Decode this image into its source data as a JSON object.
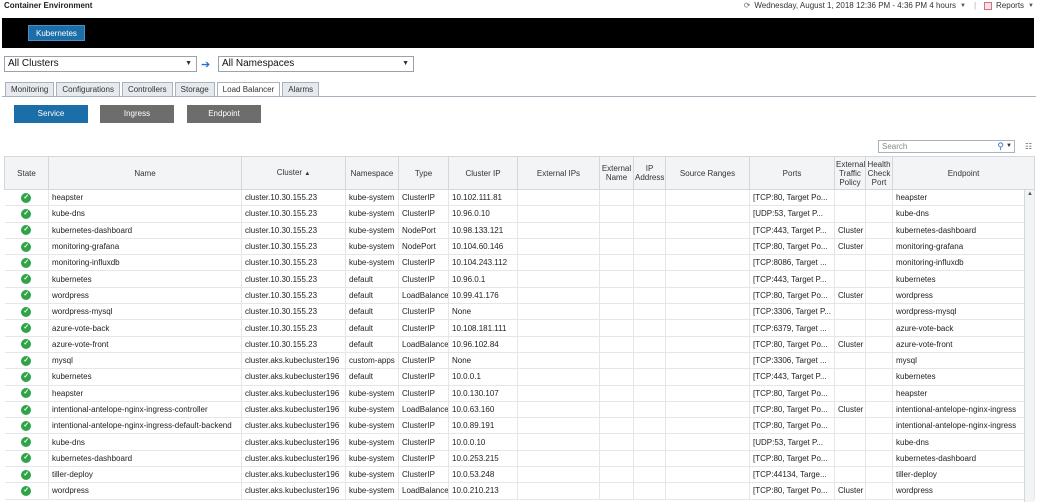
{
  "app": {
    "title": "Container Environment",
    "time_range": "Wednesday, August 1, 2018 12:36 PM - 4:36 PM 4 hours",
    "reports_label": "Reports"
  },
  "header": {
    "kubernetes_button": "Kubernetes"
  },
  "filters": {
    "cluster_value": "All Clusters",
    "namespace_value": "All Namespaces"
  },
  "tabs": [
    {
      "label": "Monitoring"
    },
    {
      "label": "Configurations"
    },
    {
      "label": "Controllers"
    },
    {
      "label": "Storage"
    },
    {
      "label": "Load Balancer",
      "active": true
    },
    {
      "label": "Alarms"
    }
  ],
  "subtabs": {
    "service": "Service",
    "ingress": "Ingress",
    "endpoint": "Endpoint"
  },
  "search": {
    "placeholder": "Search"
  },
  "colors": {
    "accent": "#1b6ea8",
    "ok": "#2fa34a",
    "secondary": "#6d6d6d"
  },
  "table": {
    "columns": [
      "State",
      "Name",
      "Cluster",
      "Namespace",
      "Type",
      "Cluster IP",
      "External IPs",
      "External Name",
      "IP Address",
      "Source Ranges",
      "Ports",
      "External Traffic Policy",
      "Health Check Port",
      "Endpoint"
    ],
    "sorted_column": "Cluster",
    "rows": [
      {
        "state": "ok",
        "name": "heapster",
        "cluster": "cluster.10.30.155.23",
        "namespace": "kube-system",
        "type": "ClusterIP",
        "cluster_ip": "10.102.111.81",
        "external_ips": "",
        "external_name": "",
        "ip_address": "",
        "source_ranges": "",
        "ports": "[TCP:80, Target Po...",
        "traffic_policy": "",
        "health_port": "",
        "endpoint": "heapster"
      },
      {
        "state": "ok",
        "name": "kube-dns",
        "cluster": "cluster.10.30.155.23",
        "namespace": "kube-system",
        "type": "ClusterIP",
        "cluster_ip": "10.96.0.10",
        "external_ips": "",
        "external_name": "",
        "ip_address": "",
        "source_ranges": "",
        "ports": "[UDP:53, Target P...",
        "traffic_policy": "",
        "health_port": "",
        "endpoint": "kube-dns"
      },
      {
        "state": "ok",
        "name": "kubernetes-dashboard",
        "cluster": "cluster.10.30.155.23",
        "namespace": "kube-system",
        "type": "NodePort",
        "cluster_ip": "10.98.133.121",
        "external_ips": "",
        "external_name": "",
        "ip_address": "",
        "source_ranges": "",
        "ports": "[TCP:443, Target P...",
        "traffic_policy": "Cluster",
        "health_port": "",
        "endpoint": "kubernetes-dashboard"
      },
      {
        "state": "ok",
        "name": "monitoring-grafana",
        "cluster": "cluster.10.30.155.23",
        "namespace": "kube-system",
        "type": "NodePort",
        "cluster_ip": "10.104.60.146",
        "external_ips": "",
        "external_name": "",
        "ip_address": "",
        "source_ranges": "",
        "ports": "[TCP:80, Target Po...",
        "traffic_policy": "Cluster",
        "health_port": "",
        "endpoint": "monitoring-grafana"
      },
      {
        "state": "ok",
        "name": "monitoring-influxdb",
        "cluster": "cluster.10.30.155.23",
        "namespace": "kube-system",
        "type": "ClusterIP",
        "cluster_ip": "10.104.243.112",
        "external_ips": "",
        "external_name": "",
        "ip_address": "",
        "source_ranges": "",
        "ports": "[TCP:8086, Target ...",
        "traffic_policy": "",
        "health_port": "",
        "endpoint": "monitoring-influxdb"
      },
      {
        "state": "ok",
        "name": "kubernetes",
        "cluster": "cluster.10.30.155.23",
        "namespace": "default",
        "type": "ClusterIP",
        "cluster_ip": "10.96.0.1",
        "external_ips": "",
        "external_name": "",
        "ip_address": "",
        "source_ranges": "",
        "ports": "[TCP:443, Target P...",
        "traffic_policy": "",
        "health_port": "",
        "endpoint": "kubernetes"
      },
      {
        "state": "ok",
        "name": "wordpress",
        "cluster": "cluster.10.30.155.23",
        "namespace": "default",
        "type": "LoadBalancer",
        "cluster_ip": "10.99.41.176",
        "external_ips": "",
        "external_name": "",
        "ip_address": "",
        "source_ranges": "",
        "ports": "[TCP:80, Target Po...",
        "traffic_policy": "Cluster",
        "health_port": "",
        "endpoint": "wordpress"
      },
      {
        "state": "ok",
        "name": "wordpress-mysql",
        "cluster": "cluster.10.30.155.23",
        "namespace": "default",
        "type": "ClusterIP",
        "cluster_ip": "None",
        "external_ips": "",
        "external_name": "",
        "ip_address": "",
        "source_ranges": "",
        "ports": "[TCP:3306, Target P...",
        "traffic_policy": "",
        "health_port": "",
        "endpoint": "wordpress-mysql"
      },
      {
        "state": "ok",
        "name": "azure-vote-back",
        "cluster": "cluster.10.30.155.23",
        "namespace": "default",
        "type": "ClusterIP",
        "cluster_ip": "10.108.181.111",
        "external_ips": "",
        "external_name": "",
        "ip_address": "",
        "source_ranges": "",
        "ports": "[TCP:6379, Target ...",
        "traffic_policy": "",
        "health_port": "",
        "endpoint": "azure-vote-back"
      },
      {
        "state": "ok",
        "name": "azure-vote-front",
        "cluster": "cluster.10.30.155.23",
        "namespace": "default",
        "type": "LoadBalancer",
        "cluster_ip": "10.96.102.84",
        "external_ips": "",
        "external_name": "",
        "ip_address": "",
        "source_ranges": "",
        "ports": "[TCP:80, Target Po...",
        "traffic_policy": "Cluster",
        "health_port": "",
        "endpoint": "azure-vote-front"
      },
      {
        "state": "ok",
        "name": "mysql",
        "cluster": "cluster.aks.kubecluster196",
        "namespace": "custom-apps",
        "type": "ClusterIP",
        "cluster_ip": "None",
        "external_ips": "",
        "external_name": "",
        "ip_address": "",
        "source_ranges": "",
        "ports": "[TCP:3306, Target ...",
        "traffic_policy": "",
        "health_port": "",
        "endpoint": "mysql"
      },
      {
        "state": "ok",
        "name": "kubernetes",
        "cluster": "cluster.aks.kubecluster196",
        "namespace": "default",
        "type": "ClusterIP",
        "cluster_ip": "10.0.0.1",
        "external_ips": "",
        "external_name": "",
        "ip_address": "",
        "source_ranges": "",
        "ports": "[TCP:443, Target P...",
        "traffic_policy": "",
        "health_port": "",
        "endpoint": "kubernetes"
      },
      {
        "state": "ok",
        "name": "heapster",
        "cluster": "cluster.aks.kubecluster196",
        "namespace": "kube-system",
        "type": "ClusterIP",
        "cluster_ip": "10.0.130.107",
        "external_ips": "",
        "external_name": "",
        "ip_address": "",
        "source_ranges": "",
        "ports": "[TCP:80, Target Po...",
        "traffic_policy": "",
        "health_port": "",
        "endpoint": "heapster"
      },
      {
        "state": "ok",
        "name": "intentional-antelope-nginx-ingress-controller",
        "cluster": "cluster.aks.kubecluster196",
        "namespace": "kube-system",
        "type": "LoadBalancer",
        "cluster_ip": "10.0.63.160",
        "external_ips": "",
        "external_name": "",
        "ip_address": "",
        "source_ranges": "",
        "ports": "[TCP:80, Target Po...",
        "traffic_policy": "Cluster",
        "health_port": "",
        "endpoint": "intentional-antelope-nginx-ingress"
      },
      {
        "state": "ok",
        "name": "intentional-antelope-nginx-ingress-default-backend",
        "cluster": "cluster.aks.kubecluster196",
        "namespace": "kube-system",
        "type": "ClusterIP",
        "cluster_ip": "10.0.89.191",
        "external_ips": "",
        "external_name": "",
        "ip_address": "",
        "source_ranges": "",
        "ports": "[TCP:80, Target Po...",
        "traffic_policy": "",
        "health_port": "",
        "endpoint": "intentional-antelope-nginx-ingress"
      },
      {
        "state": "ok",
        "name": "kube-dns",
        "cluster": "cluster.aks.kubecluster196",
        "namespace": "kube-system",
        "type": "ClusterIP",
        "cluster_ip": "10.0.0.10",
        "external_ips": "",
        "external_name": "",
        "ip_address": "",
        "source_ranges": "",
        "ports": "[UDP:53, Target P...",
        "traffic_policy": "",
        "health_port": "",
        "endpoint": "kube-dns"
      },
      {
        "state": "ok",
        "name": "kubernetes-dashboard",
        "cluster": "cluster.aks.kubecluster196",
        "namespace": "kube-system",
        "type": "ClusterIP",
        "cluster_ip": "10.0.253.215",
        "external_ips": "",
        "external_name": "",
        "ip_address": "",
        "source_ranges": "",
        "ports": "[TCP:80, Target Po...",
        "traffic_policy": "",
        "health_port": "",
        "endpoint": "kubernetes-dashboard"
      },
      {
        "state": "ok",
        "name": "tiller-deploy",
        "cluster": "cluster.aks.kubecluster196",
        "namespace": "kube-system",
        "type": "ClusterIP",
        "cluster_ip": "10.0.53.248",
        "external_ips": "",
        "external_name": "",
        "ip_address": "",
        "source_ranges": "",
        "ports": "[TCP:44134, Targe...",
        "traffic_policy": "",
        "health_port": "",
        "endpoint": "tiller-deploy"
      },
      {
        "state": "ok",
        "name": "wordpress",
        "cluster": "cluster.aks.kubecluster196",
        "namespace": "kube-system",
        "type": "LoadBalancer",
        "cluster_ip": "10.0.210.213",
        "external_ips": "",
        "external_name": "",
        "ip_address": "",
        "source_ranges": "",
        "ports": "[TCP:80, Target Po...",
        "traffic_policy": "Cluster",
        "health_port": "",
        "endpoint": "wordpress"
      }
    ]
  }
}
